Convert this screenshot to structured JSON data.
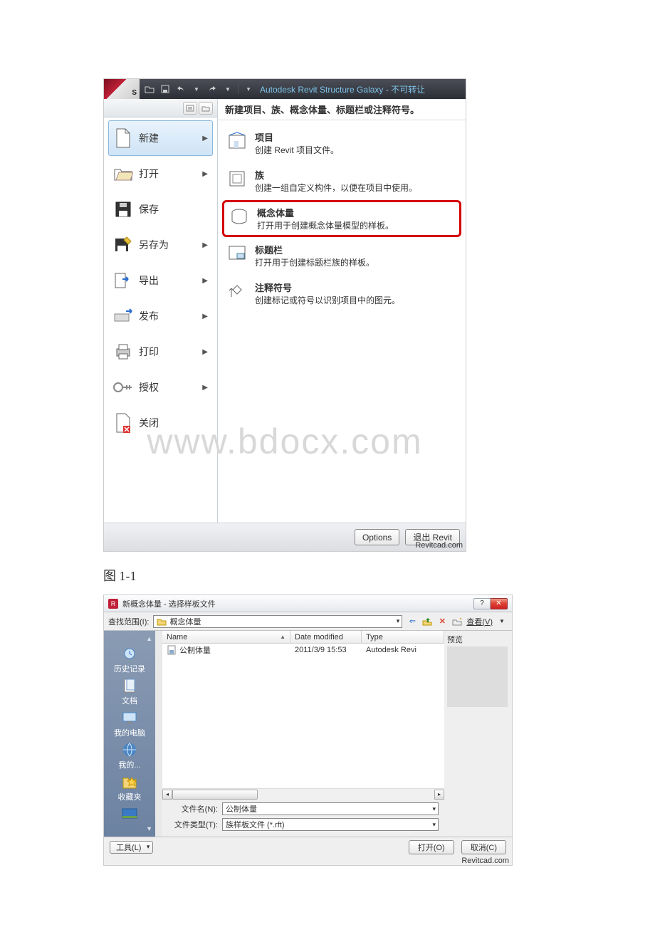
{
  "app": {
    "logo_letter": "S",
    "title": "Autodesk Revit Structure Galaxy - 不可转让",
    "watermark": "www.bdocx.com"
  },
  "qat": {
    "sep": "·"
  },
  "left_menu": {
    "items": [
      {
        "label": "新建",
        "has_arrow": true,
        "selected": true
      },
      {
        "label": "打开",
        "has_arrow": true,
        "selected": false
      },
      {
        "label": "保存",
        "has_arrow": false,
        "selected": false
      },
      {
        "label": "另存为",
        "has_arrow": true,
        "selected": false
      },
      {
        "label": "导出",
        "has_arrow": true,
        "selected": false
      },
      {
        "label": "发布",
        "has_arrow": true,
        "selected": false
      },
      {
        "label": "打印",
        "has_arrow": true,
        "selected": false
      },
      {
        "label": "授权",
        "has_arrow": true,
        "selected": false
      },
      {
        "label": "关闭",
        "has_arrow": false,
        "selected": false
      }
    ]
  },
  "right_panel": {
    "header": "新建项目、族、概念体量、标题栏或注释符号。",
    "items": [
      {
        "title": "项目",
        "desc": "创建 Revit 项目文件。"
      },
      {
        "title": "族",
        "desc": "创建一组自定义构件，以便在项目中使用。"
      },
      {
        "title": "概念体量",
        "desc": "打开用于创建概念体量模型的样板。",
        "highlight": true
      },
      {
        "title": "标题栏",
        "desc": "打开用于创建标题栏族的样板。"
      },
      {
        "title": "注释符号",
        "desc": "创建标记或符号以识别项目中的图元。"
      }
    ]
  },
  "footer": {
    "options": "Options",
    "exit": "退出 Revit",
    "credit": "Revitcad.com"
  },
  "caption": "图 1-1",
  "dialog": {
    "title": "新概念体量 - 选择样板文件",
    "look_in_label": "查找范围(I):",
    "look_in_value": "概念体量",
    "view_label": "查看(V)",
    "columns": {
      "name": "Name",
      "date": "Date modified",
      "type": "Type"
    },
    "row": {
      "name": "公制体量",
      "date": "2011/3/9 15:53",
      "type": "Autodesk Revi"
    },
    "places": [
      "历史记录",
      "文档",
      "我的电脑",
      "我的...",
      "收藏夹"
    ],
    "filename_label": "文件名(N):",
    "filename_value": "公制体量",
    "filetype_label": "文件类型(T):",
    "filetype_value": "族样板文件 (*.rft)",
    "preview_label": "预览",
    "tools": "工具(L)",
    "open": "打开(O)",
    "cancel": "取消(C)",
    "credit": "Revitcad.com"
  }
}
